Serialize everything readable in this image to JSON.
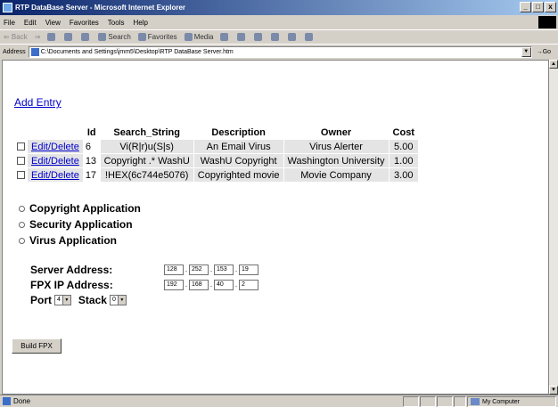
{
  "window": {
    "title": "RTP DataBase Server - Microsoft Internet Explorer",
    "buttons": [
      "_",
      "□",
      "x"
    ]
  },
  "menu": [
    "File",
    "Edit",
    "View",
    "Favorites",
    "Tools",
    "Help"
  ],
  "toolbar": {
    "back": "⇐ Back",
    "forward": "⇒",
    "search": "Search",
    "favorites": "Favorites",
    "media": "Media"
  },
  "address": {
    "label": "Address",
    "value": "C:\\Documents and Settings\\jmm5\\Desktop\\RTP DataBase Server.htm",
    "go": "Go"
  },
  "page": {
    "add_entry": "Add Entry",
    "table": {
      "headers": [
        "Id",
        "Search_String",
        "Description",
        "Owner",
        "Cost"
      ],
      "rows": [
        {
          "link": "Edit/Delete",
          "id": "6",
          "search": "Vi(R|r)u(S|s)",
          "description": "An Email Virus",
          "owner": "Virus Alerter",
          "cost": "5.00"
        },
        {
          "link": "Edit/Delete",
          "id": "13",
          "search": "Copyright .* WashU",
          "description": "WashU Copyright",
          "owner": "Washington University",
          "cost": "1.00"
        },
        {
          "link": "Edit/Delete",
          "id": "17",
          "search": "!HEX(6c744e5076)",
          "description": "Copyrighted movie",
          "owner": "Movie Company",
          "cost": "3.00"
        }
      ]
    },
    "radios": [
      "Copyright Application",
      "Security Application",
      "Virus Application"
    ],
    "server_address": {
      "label": "Server Address:",
      "octets": [
        "128",
        "252",
        "153",
        "19"
      ]
    },
    "fpx_ip": {
      "label": "FPX IP Address:",
      "octets": [
        "192",
        "168",
        "40",
        "2"
      ]
    },
    "port": {
      "label": "Port",
      "value": "4"
    },
    "stack": {
      "label": "Stack",
      "value": "0"
    },
    "build_button": "Build FPX"
  },
  "status": {
    "text": "Done",
    "zone": "My Computer"
  }
}
